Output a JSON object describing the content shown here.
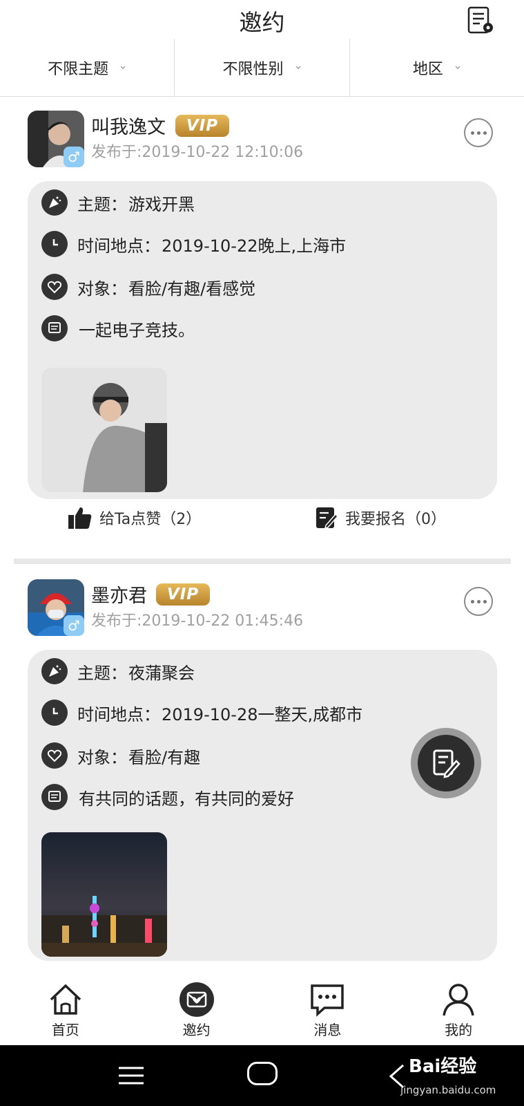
{
  "header": {
    "title": "邀约"
  },
  "filters": [
    {
      "label": "不限主题"
    },
    {
      "label": "不限性别"
    },
    {
      "label": "地区"
    }
  ],
  "posts": [
    {
      "username": "叫我逸文",
      "vip": "VIP",
      "gender_symbol": "♂",
      "time": "发布于:2019-10-22 12:10:06",
      "topic_label": "主题：",
      "topic": "游戏开黑",
      "when_label": "时间地点：",
      "when": "2019-10-22晚上,上海市",
      "target_label": "对象：",
      "target": "看脸/有趣/看感觉",
      "desc": "一起电子竞技。",
      "like": "给Ta点赞（2）",
      "signup": "我要报名（0）"
    },
    {
      "username": "墨亦君",
      "vip": "VIP",
      "gender_symbol": "♂",
      "time": "发布于:2019-10-22 01:45:46",
      "topic_label": "主题：",
      "topic": "夜蒲聚会",
      "when_label": "时间地点：",
      "when": "2019-10-28一整天,成都市",
      "target_label": "对象：",
      "target": "看脸/有趣",
      "desc": "有共同的话题，有共同的爱好"
    }
  ],
  "tabbar": [
    {
      "label": "首页",
      "icon": "home-icon"
    },
    {
      "label": "邀约",
      "icon": "invite-icon"
    },
    {
      "label": "消息",
      "icon": "message-icon"
    },
    {
      "label": "我的",
      "icon": "profile-icon"
    }
  ],
  "watermark": {
    "logo": "Bai经验",
    "url": "jingyan.baidu.com"
  }
}
